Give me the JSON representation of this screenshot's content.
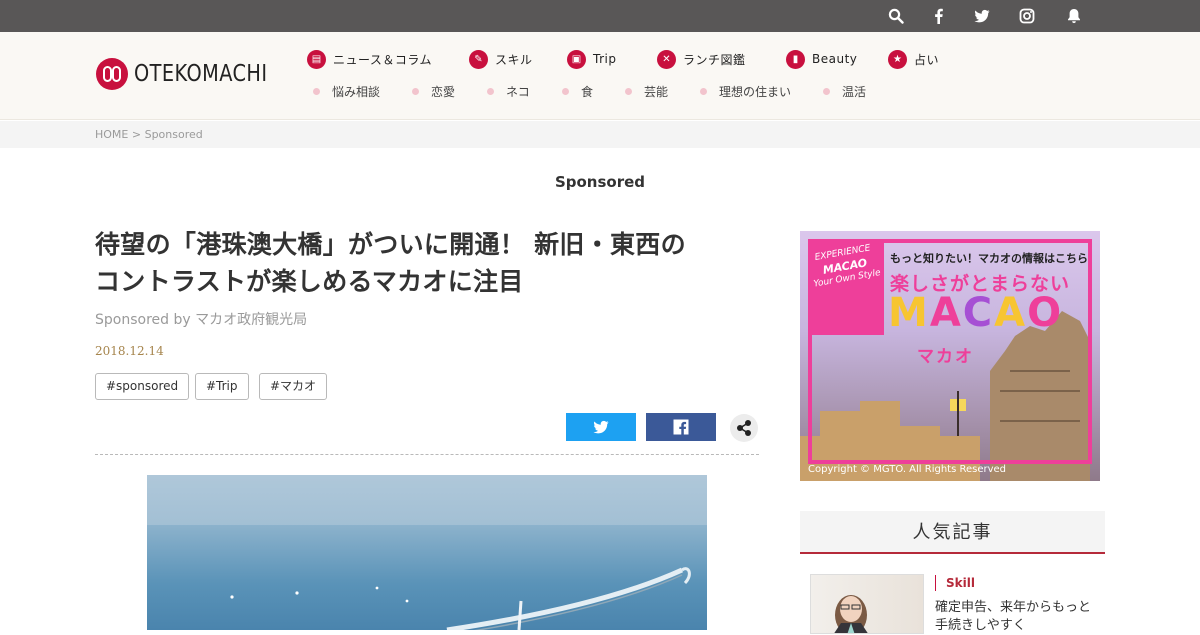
{
  "topbar": {
    "icons": [
      "search-icon",
      "facebook-icon",
      "twitter-icon",
      "instagram-icon",
      "bell-icon"
    ]
  },
  "brand": {
    "logo_text": "OTEKOMACHI",
    "accent": "#c8103e"
  },
  "nav_primary": [
    {
      "label": "ニュース＆コラム",
      "icon": "newspaper-icon"
    },
    {
      "label": "スキル",
      "icon": "pencil-icon"
    },
    {
      "label": "Trip",
      "icon": "suitcase-icon"
    },
    {
      "label": "ランチ図鑑",
      "icon": "cutlery-icon"
    },
    {
      "label": "Beauty",
      "icon": "lipstick-icon"
    },
    {
      "label": "占い",
      "icon": "star-icon"
    }
  ],
  "nav_secondary": [
    {
      "label": "悩み相談"
    },
    {
      "label": "恋愛"
    },
    {
      "label": "ネコ"
    },
    {
      "label": "食"
    },
    {
      "label": "芸能"
    },
    {
      "label": "理想の住まい"
    },
    {
      "label": "温活"
    }
  ],
  "breadcrumb": "HOME > Sponsored",
  "section_title": "Sponsored",
  "article": {
    "title_line1": "待望の「港珠澳大橋」がついに開通！ 新旧・東西の",
    "title_line2": "コントラストが楽しめるマカオに注目",
    "byline": "Sponsored by マカオ政府観光局",
    "date": "2018.12.14",
    "tags": [
      "#sponsored",
      "#Trip",
      "#マカオ"
    ]
  },
  "share": {
    "twitter_icon": "twitter-icon",
    "facebook_icon": "facebook-icon",
    "share_icon": "share-icon",
    "twitter_color": "#1da1f2",
    "facebook_color": "#3b5998"
  },
  "ad": {
    "badge_line1": "EXPERIENCE",
    "badge_line2": "MACAO",
    "badge_line3": "Your Own Style",
    "top_text": "もっと知りたい！マカオの情報はこちら",
    "catch": "楽しさがとまらない",
    "macao": [
      "M",
      "A",
      "C",
      "A",
      "O"
    ],
    "kana": "マカオ",
    "copyright": "Copyright © MGTO. All Rights Reserved"
  },
  "popular": {
    "heading": "人気記事",
    "item": {
      "category": "Skill",
      "text": "確定申告、来年からもっと手続きしやすく"
    }
  }
}
